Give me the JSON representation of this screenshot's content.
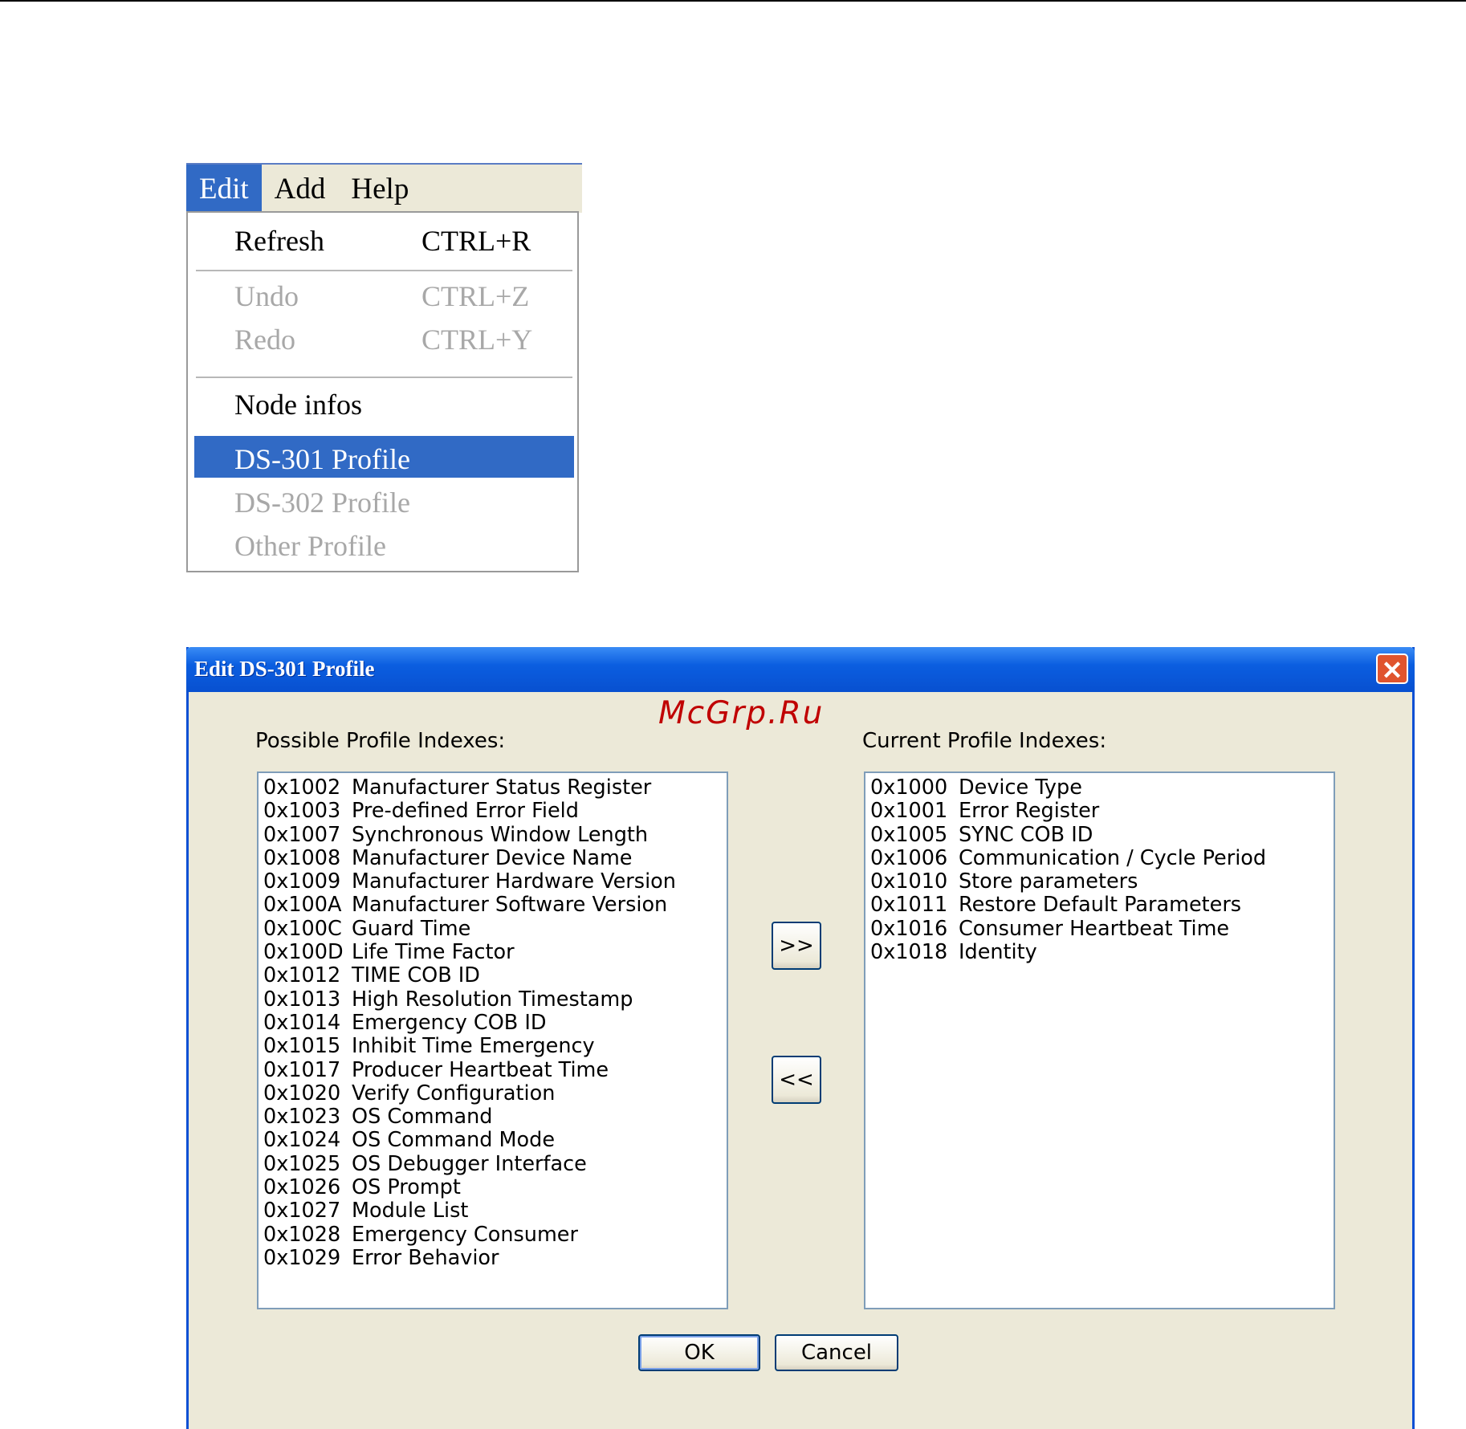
{
  "menu": {
    "bar": [
      "Edit",
      "Add",
      "Help"
    ],
    "active": "Edit",
    "items": [
      {
        "label": "Refresh",
        "shortcut": "CTRL+R",
        "state": "enabled"
      },
      {
        "label": "Undo",
        "shortcut": "CTRL+Z",
        "state": "disabled"
      },
      {
        "label": "Redo",
        "shortcut": "CTRL+Y",
        "state": "disabled"
      },
      {
        "label": "Node infos",
        "shortcut": "",
        "state": "enabled"
      },
      {
        "label": "DS-301 Profile",
        "shortcut": "",
        "state": "selected"
      },
      {
        "label": "DS-302 Profile",
        "shortcut": "",
        "state": "disabled"
      },
      {
        "label": "Other Profile",
        "shortcut": "",
        "state": "disabled"
      }
    ]
  },
  "dialog": {
    "title": "Edit DS-301 Profile",
    "close_glyph": "✕",
    "watermark": "McGrp.Ru",
    "possible_label": "Possible Profile Indexes:",
    "current_label": "Current Profile Indexes:",
    "add_label": ">>",
    "remove_label": "<<",
    "ok_label": "OK",
    "cancel_label": "Cancel",
    "possible": [
      {
        "index": "0x1002",
        "name": "Manufacturer Status Register"
      },
      {
        "index": "0x1003",
        "name": "Pre-defined Error Field"
      },
      {
        "index": "0x1007",
        "name": "Synchronous Window Length"
      },
      {
        "index": "0x1008",
        "name": "Manufacturer Device Name"
      },
      {
        "index": "0x1009",
        "name": "Manufacturer Hardware Version"
      },
      {
        "index": "0x100A",
        "name": "Manufacturer Software Version"
      },
      {
        "index": "0x100C",
        "name": "Guard Time"
      },
      {
        "index": "0x100D",
        "name": "Life Time Factor"
      },
      {
        "index": "0x1012",
        "name": "TIME COB ID"
      },
      {
        "index": "0x1013",
        "name": "High Resolution Timestamp"
      },
      {
        "index": "0x1014",
        "name": "Emergency COB ID"
      },
      {
        "index": "0x1015",
        "name": "Inhibit Time Emergency"
      },
      {
        "index": "0x1017",
        "name": "Producer Heartbeat Time"
      },
      {
        "index": "0x1020",
        "name": "Verify Configuration"
      },
      {
        "index": "0x1023",
        "name": "OS Command"
      },
      {
        "index": "0x1024",
        "name": "OS Command Mode"
      },
      {
        "index": "0x1025",
        "name": "OS Debugger Interface"
      },
      {
        "index": "0x1026",
        "name": "OS Prompt"
      },
      {
        "index": "0x1027",
        "name": "Module List"
      },
      {
        "index": "0x1028",
        "name": "Emergency Consumer"
      },
      {
        "index": "0x1029",
        "name": "Error Behavior"
      }
    ],
    "current": [
      {
        "index": "0x1000",
        "name": "Device Type"
      },
      {
        "index": "0x1001",
        "name": "Error Register"
      },
      {
        "index": "0x1005",
        "name": "SYNC COB ID"
      },
      {
        "index": "0x1006",
        "name": "Communication / Cycle Period"
      },
      {
        "index": "0x1010",
        "name": "Store parameters"
      },
      {
        "index": "0x1011",
        "name": "Restore Default Parameters"
      },
      {
        "index": "0x1016",
        "name": "Consumer Heartbeat Time"
      },
      {
        "index": "0x1018",
        "name": "Identity"
      }
    ]
  }
}
